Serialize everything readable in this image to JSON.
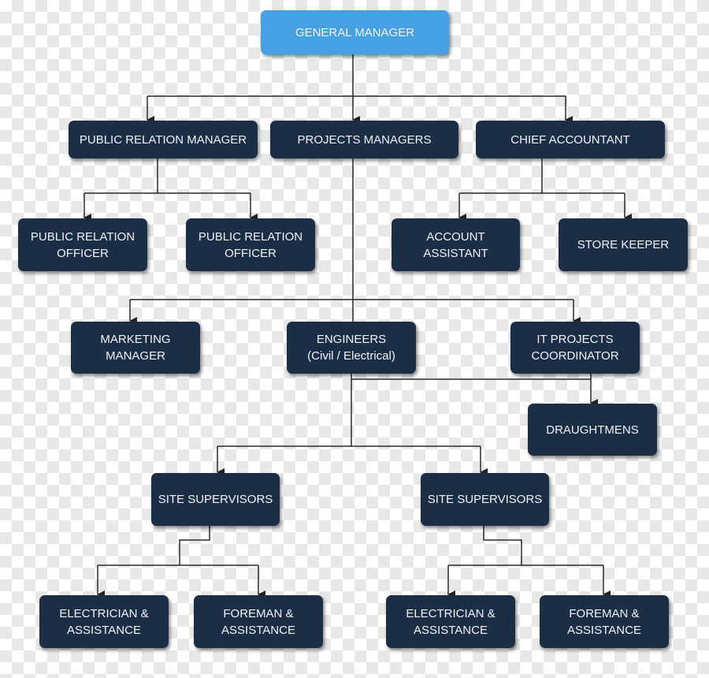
{
  "colors": {
    "root": "#47a0e2",
    "node": "#1b2e45",
    "connector": "#2a2a2a",
    "text": "#eef3f8"
  },
  "nodes": {
    "general_manager": "GENERAL MANAGER",
    "public_relation_manager": "PUBLIC RELATION MANAGER",
    "projects_managers": "PROJECTS MANAGERS",
    "chief_accountant": "CHIEF ACCOUNTANT",
    "pr_officer_1": "PUBLIC RELATION\nOFFICER",
    "pr_officer_2": "PUBLIC RELATION\nOFFICER",
    "account_assistant": "ACCOUNT\nASSISTANT",
    "store_keeper": "STORE KEEPER",
    "marketing_manager": "MARKETING\nMANAGER",
    "engineers": "ENGINEERS\n(Civil / Electrical)",
    "it_projects_coordinator": "IT PROJECTS\nCOORDINATOR",
    "draughtmens": "DRAUGHTMENS",
    "site_supervisors_1": "SITE SUPERVISORS",
    "site_supervisors_2": "SITE SUPERVISORS",
    "electrician_1": "ELECTRICIAN &\nASSISTANCE",
    "foreman_1": "FOREMAN &\nASSISTANCE",
    "electrician_2": "ELECTRICIAN &\nASSISTANCE",
    "foreman_2": "FOREMAN &\nASSISTANCE"
  }
}
